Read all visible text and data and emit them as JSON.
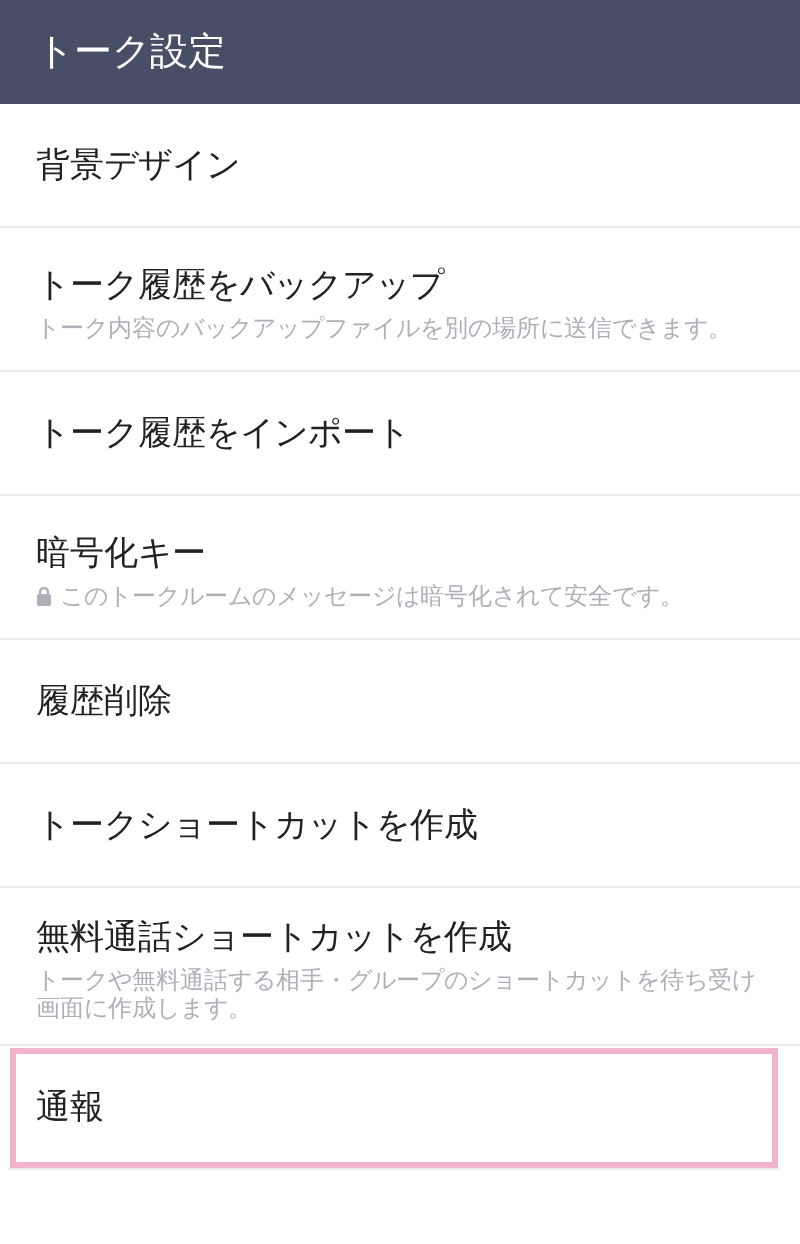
{
  "header": {
    "title": "トーク設定"
  },
  "items": [
    {
      "label": "背景デザイン",
      "highlighted": false
    },
    {
      "label": "トーク履歴をバックアップ",
      "description": "トーク内容のバックアップファイルを別の場所に送信できます。",
      "highlighted": false
    },
    {
      "label": "トーク履歴をインポート",
      "highlighted": false
    },
    {
      "label": "暗号化キー",
      "description": "このトークルームのメッセージは暗号化されて安全です。",
      "locked": true,
      "highlighted": false
    },
    {
      "label": "履歴削除",
      "highlighted": false
    },
    {
      "label": "トークショートカットを作成",
      "highlighted": false
    },
    {
      "label": "無料通話ショートカットを作成",
      "description": "トークや無料通話する相手・グループのショートカットを待ち受け画面に作成します。",
      "highlighted": false
    },
    {
      "label": "通報",
      "highlighted": true
    }
  ]
}
